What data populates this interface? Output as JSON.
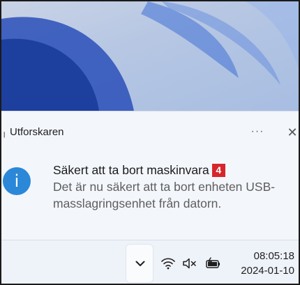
{
  "notification": {
    "app_name": "Utforskaren",
    "more_label": "···",
    "close_label": "✕",
    "icon": "info-icon",
    "icon_glyph": "i",
    "title": "Säkert att ta bort maskinvara",
    "title_badge": "4",
    "body": "Det är nu säkert att ta bort enheten USB-masslagringsenhet från datorn."
  },
  "taskbar": {
    "overflow_icon": "chevron-up-icon",
    "tray_icons": [
      "wifi-icon",
      "volume-muted-icon",
      "battery-charging-icon"
    ],
    "time": "08:05:18",
    "date": "2024-01-10"
  },
  "colors": {
    "accent": "#2b88d8",
    "badge": "#d6262b",
    "toast_background": "#f3f6fb",
    "taskbar_background": "#eef2f9"
  }
}
